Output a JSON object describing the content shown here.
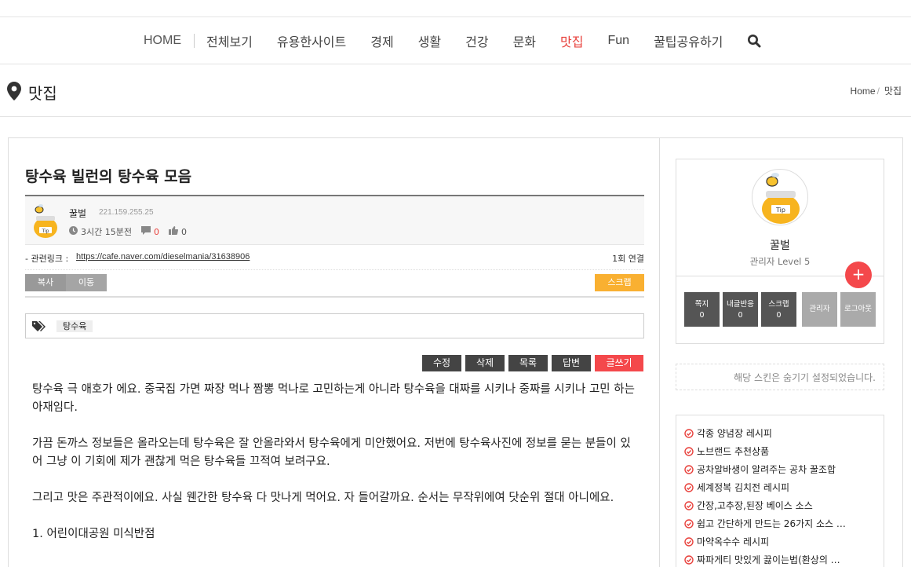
{
  "nav": {
    "home": "HOME",
    "items": [
      "전체보기",
      "유용한사이트",
      "경제",
      "생활",
      "건강",
      "문화",
      "맛집",
      "Fun",
      "꿀팁공유하기"
    ],
    "active": "맛집"
  },
  "page": {
    "title": "맛집",
    "breadcrumb": {
      "home": "Home",
      "slash": "/",
      "current": "맛집"
    }
  },
  "post": {
    "title": "탕수육 빌런의 탕수육 모음",
    "author": "꿀벌",
    "ip": "221.159.255.25",
    "time": "3시간 15분전",
    "comments": "0",
    "likes": "0",
    "link_label": "- 관련링크 :",
    "link_url": "https://cafe.naver.com/dieselmania/31638906",
    "link_count": "1회 연결",
    "buttons": {
      "copy": "복사",
      "move": "이동",
      "scrap": "스크랩"
    },
    "tag": "탕수육",
    "actions": {
      "edit": "수정",
      "delete": "삭제",
      "list": "목록",
      "reply": "답변",
      "write": "글쓰기"
    },
    "paragraphs": [
      "탕수육 극 애호가 에요. 중국집 가면 짜장 먹나 짬뽕 먹나로 고민하는게 아니라 탕수육을 대짜를 시키나 중짜를 시키나 고민 하는 아재임다.",
      "가끔 돈까스 정보들은 올라오는데 탕수육은 잘 안올라와서 탕수육에게 미안했어요. 저번에 탕수육사진에 정보를 묻는 분들이 있어 그냥 이 기회에 제가 괜찮게 먹은 탕수육들 끄적여 보려구요.",
      "그리고 맛은 주관적이에요. 사실 웬간한 탕수육 다 맛나게 먹어요. 자 들어갈까요. 순서는 무작위에여 닷순위 절대 아니에요.",
      "1. 어린이대공원 미식반점"
    ]
  },
  "profile": {
    "name": "꿀벌",
    "level": "관리자 Level 5",
    "plus": "+",
    "buttons": [
      {
        "label": "쪽지",
        "count": "0"
      },
      {
        "label": "내글반응",
        "count": "0"
      },
      {
        "label": "스크랩",
        "count": "0"
      },
      {
        "label": "관리자"
      },
      {
        "label": "로그아웃"
      }
    ]
  },
  "notice": "해당 스킨은 숨기기 설정되었습니다.",
  "popular": [
    "각종 양념장 레시피",
    "노브랜드 추천상품",
    "공차알바생이 알려주는 공차 꿀조합",
    "세계정복 김치전 레시피",
    "간장,고추장,된장 베이스 소스",
    "쉽고 간단하게 만드는 26가지 소스 …",
    "마약옥수수 레시피",
    "짜파게티 맛있게 끓이는법(환상의 …"
  ],
  "colors": {
    "accent": "#e8413c",
    "scrap": "#f9b031",
    "dark": "#444444"
  }
}
